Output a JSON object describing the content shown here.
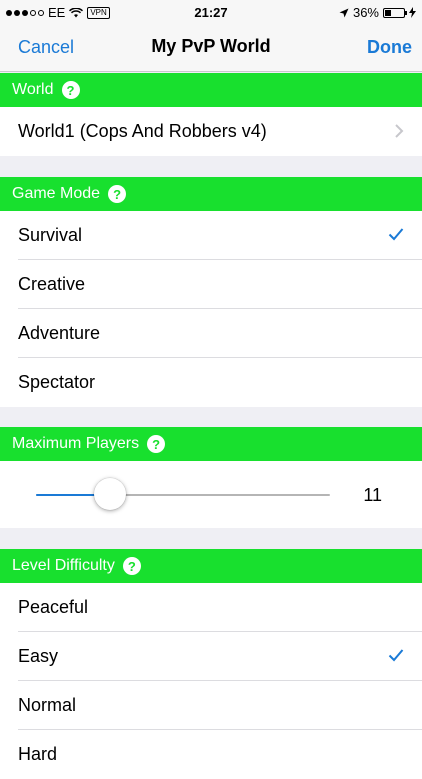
{
  "status": {
    "carrier": "EE",
    "vpn": "VPN",
    "time": "21:27",
    "battery": "36%",
    "battery_level": 0.36
  },
  "nav": {
    "cancel": "Cancel",
    "title": "My PvP World",
    "done": "Done"
  },
  "world": {
    "header": "World",
    "help": "?",
    "value": "World1 (Cops And Robbers v4)"
  },
  "game_mode": {
    "header": "Game Mode",
    "help": "?",
    "options": [
      "Survival",
      "Creative",
      "Adventure",
      "Spectator"
    ],
    "selected": "Survival"
  },
  "max_players": {
    "header": "Maximum Players",
    "help": "?",
    "value": "11",
    "slider_fraction": 0.25
  },
  "difficulty": {
    "header": "Level Difficulty",
    "help": "?",
    "options": [
      "Peaceful",
      "Easy",
      "Normal",
      "Hard"
    ],
    "selected": "Easy"
  },
  "colors": {
    "accent": "#1a7ad6",
    "section_header": "#18e02e",
    "background": "#efeff4"
  }
}
